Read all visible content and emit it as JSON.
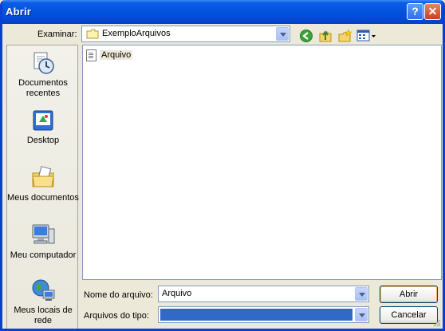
{
  "window": {
    "title": "Abrir"
  },
  "lookin": {
    "label": "Examinar:",
    "value": "ExemploArquivos"
  },
  "places": [
    {
      "label": "Documentos recentes",
      "icon": "recent-documents-icon"
    },
    {
      "label": "Desktop",
      "icon": "desktop-icon"
    },
    {
      "label": "Meus documentos",
      "icon": "my-documents-icon"
    },
    {
      "label": "Meu computador",
      "icon": "my-computer-icon"
    },
    {
      "label": "Meus locais de rede",
      "icon": "network-places-icon"
    }
  ],
  "files": [
    {
      "name": "Arquivo",
      "icon": "text-file-icon"
    }
  ],
  "filename": {
    "label": "Nome do arquivo:",
    "value": "Arquivo"
  },
  "filetype": {
    "label": "Arquivos do tipo:",
    "value": ""
  },
  "buttons": {
    "open": "Abrir",
    "cancel": "Cancelar"
  },
  "titlebar_buttons": {
    "help": "?",
    "close": "✕"
  }
}
